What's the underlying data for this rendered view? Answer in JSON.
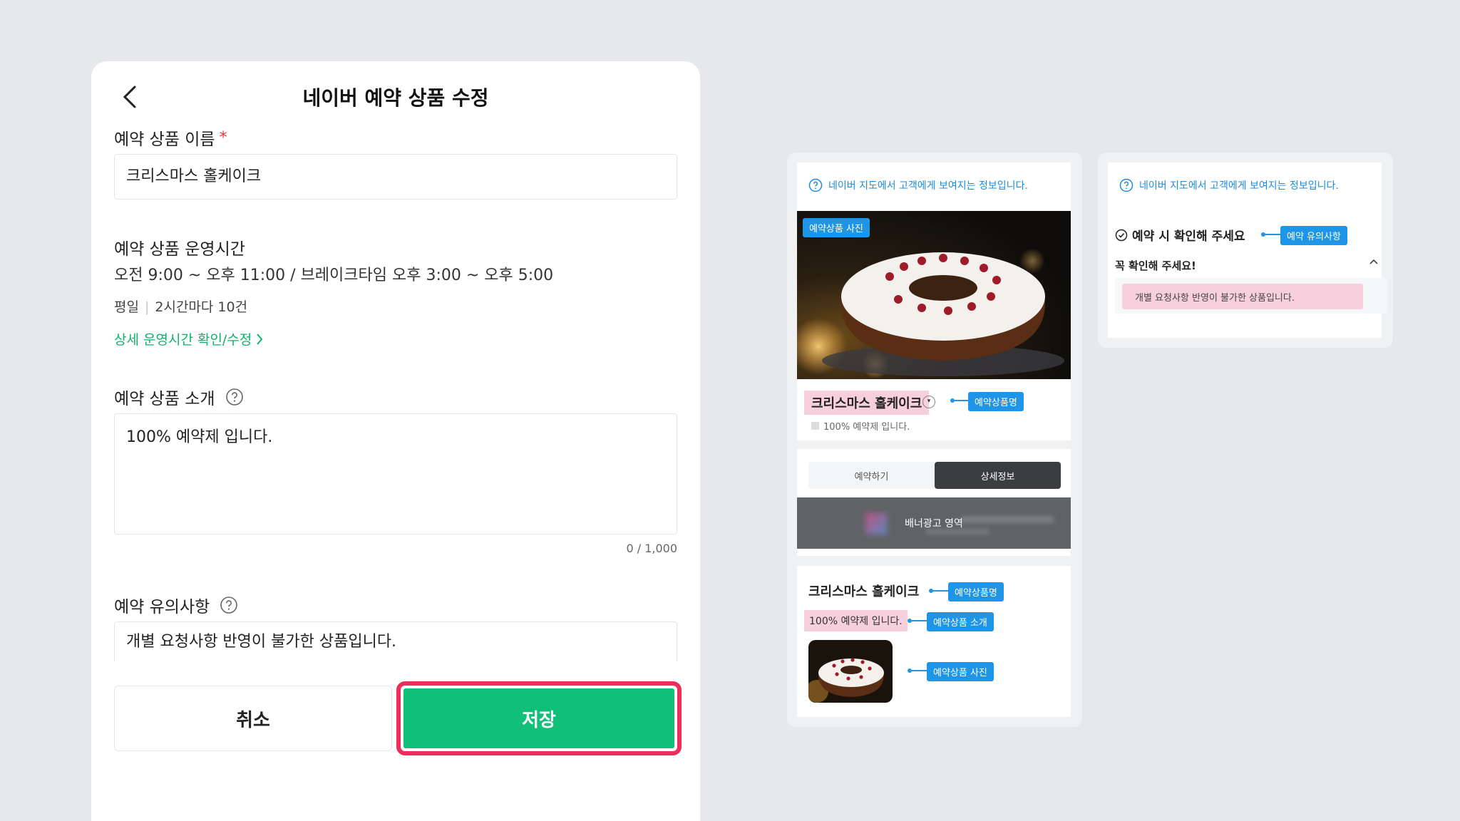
{
  "edit": {
    "title": "네이버 예약 상품 수정",
    "name_label": "예약 상품 이름",
    "name_required": "*",
    "name_value": "크리스마스 홀케이크",
    "hours_label": "예약 상품 운영시간",
    "hours_text": "오전 9:00 ~ 오후 11:00 / 브레이크타임 오후 3:00 ~ 오후 5:00",
    "weekday_label": "평일",
    "weekday_sep": "|",
    "weekday_text": "2시간마다 10건",
    "hours_link": "상세 운영시간 확인/수정",
    "intro_label": "예약 상품 소개",
    "intro_value": "100% 예약제 입니다.",
    "intro_counter": "0 / 1,000",
    "notice_label": "예약 유의사항",
    "notice_value": "개별 요청사항 반영이 불가한 상품입니다.",
    "cancel_label": "취소",
    "save_label": "저장"
  },
  "preview1": {
    "info": "네이버 지도에서 고객에게 보여지는 정보입니다.",
    "photo_tag": "예약상품 사진",
    "product_name": "크리스마스 홀케이크",
    "dropdown_glyph": "▾",
    "name_tag": "예약상품명",
    "short_desc": "100% 예약제 입니다.",
    "tab_book": "예약하기",
    "tab_detail": "상세정보",
    "banner": "배너광고 영역",
    "detail_name": "크리스마스 홀케이크",
    "detail_name_tag": "예약상품명",
    "detail_desc": "100% 예약제 입니다.",
    "detail_desc_tag": "예약상품 소개",
    "detail_photo_tag": "예약상품 사진"
  },
  "preview2": {
    "info": "네이버 지도에서 고객에게 보여지는 정보입니다.",
    "notice_title": "예약 시 확인해 주세요",
    "notice_tag": "예약 유의사항",
    "must_check": "꼭 확인해 주세요!",
    "notice_text": "개별 요청사항 반영이 불가한 상품입니다."
  },
  "colors": {
    "accent_green": "#10c078",
    "link_green": "#10b36b",
    "highlight_border": "#ef2d5b",
    "tag_blue": "#1e95e6",
    "highlight_pink": "#f8cfdc"
  }
}
